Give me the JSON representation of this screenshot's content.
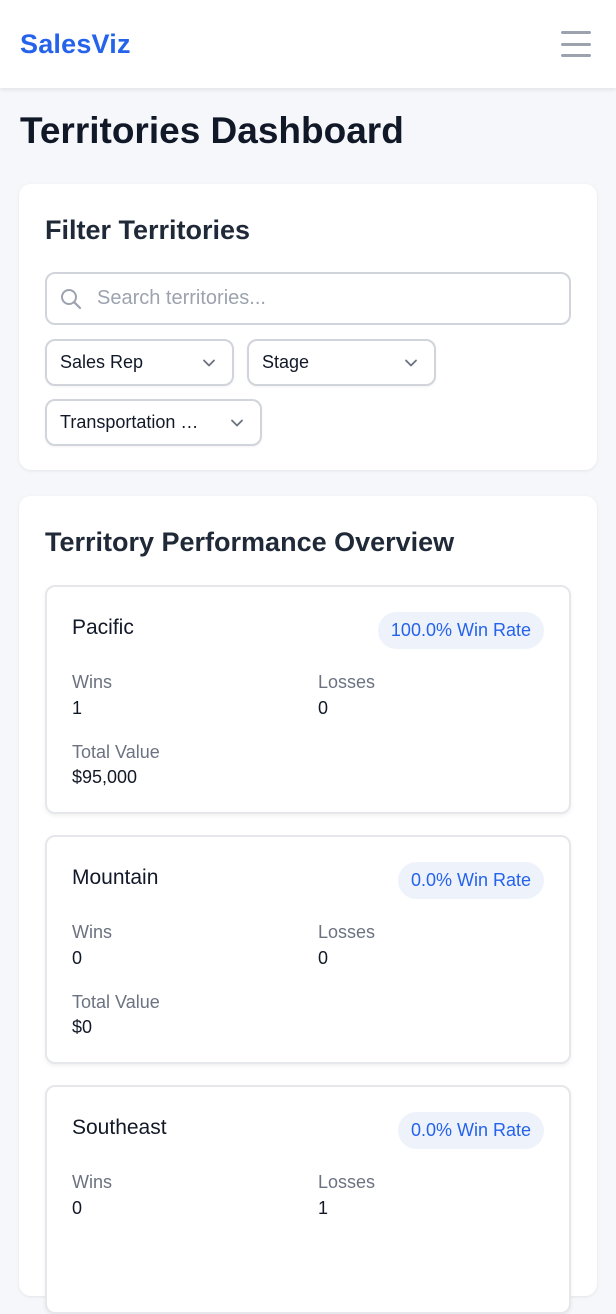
{
  "app": {
    "brand": "SalesViz"
  },
  "page": {
    "title": "Territories Dashboard"
  },
  "filters": {
    "title": "Filter Territories",
    "search": {
      "placeholder": "Search territories...",
      "value": ""
    },
    "selects": {
      "sales_rep": "Sales Rep",
      "stage": "Stage",
      "industry": "Transportation & Logistics"
    }
  },
  "overview": {
    "title": "Territory Performance Overview",
    "labels": {
      "wins": "Wins",
      "losses": "Losses",
      "total_value": "Total Value"
    },
    "territories": [
      {
        "name": "Pacific",
        "win_rate": "100.0% Win Rate",
        "wins": "1",
        "losses": "0",
        "total_value": "$95,000"
      },
      {
        "name": "Mountain",
        "win_rate": "0.0% Win Rate",
        "wins": "0",
        "losses": "0",
        "total_value": "$0"
      },
      {
        "name": "Southeast",
        "win_rate": "0.0% Win Rate",
        "wins": "0",
        "losses": "1",
        "total_value": ""
      }
    ]
  },
  "colors": {
    "accent": "#2563eb",
    "badge_bg": "#eef2fb",
    "page_bg": "#f5f7fa"
  }
}
